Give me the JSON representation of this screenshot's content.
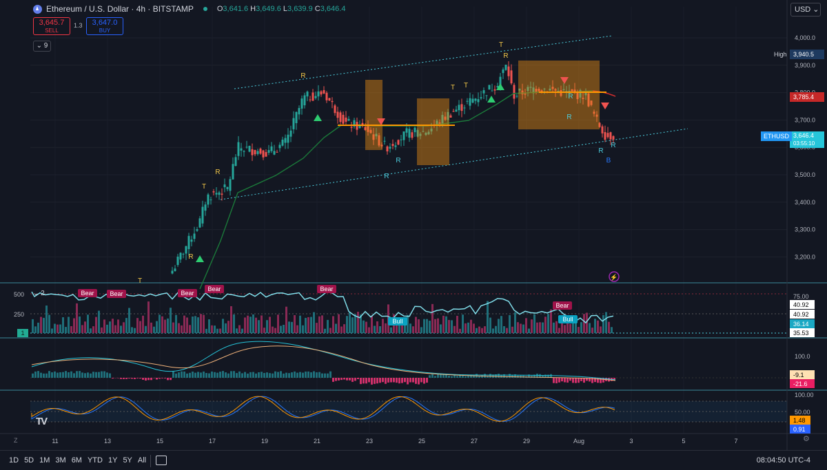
{
  "legend": {
    "symbol": "Ethereum / U.S. Dollar · 4h · BITSTAMP",
    "open_label": "O",
    "open": "3,641.6",
    "high_label": "H",
    "high": "3,649.6",
    "low_label": "L",
    "low": "3,639.9",
    "close_label": "C",
    "close": "3,646.4"
  },
  "trade": {
    "sell_price": "3,645.7",
    "sell_label": "SELL",
    "spread": "1.3",
    "buy_price": "3,647.0",
    "buy_label": "BUY"
  },
  "indicator_count": "9",
  "currency": "USD",
  "price_axis": {
    "ticks": [
      "4,000.0",
      "3,900.0",
      "3,800.0",
      "3,700.0",
      "3,600.0",
      "3,500.0",
      "3,400.0",
      "3,300.0",
      "3,200.0"
    ],
    "high_label": "High",
    "high_value": "3,940.5",
    "red_value": "3,785.4",
    "symbol_tag": "ETHUSD",
    "last_value": "3,646.4",
    "countdown": "03:55:10"
  },
  "pane2": {
    "ticks": [
      "500",
      "250"
    ],
    "collapse_num": "2",
    "right_labels": [
      "75.00",
      "40.92",
      "40.92",
      "36.14",
      "35.53"
    ],
    "tags": [
      "Bear",
      "Bear",
      "Bear",
      "Bear",
      "Bear",
      "Bull",
      "Bear",
      "Bull"
    ],
    "pane_index": "1"
  },
  "pane3": {
    "tick": "100.0",
    "labels": [
      "-9.1",
      "-21.6"
    ]
  },
  "pane4": {
    "ticks": [
      "100.00",
      "50.00"
    ],
    "labels": [
      "1.48",
      "0.91"
    ]
  },
  "time_axis": [
    "11",
    "13",
    "15",
    "17",
    "19",
    "21",
    "23",
    "25",
    "27",
    "29",
    "Aug",
    "3",
    "5",
    "7"
  ],
  "bottom": {
    "ranges": [
      "1D",
      "5D",
      "1M",
      "3M",
      "6M",
      "YTD",
      "1Y",
      "5Y",
      "All"
    ],
    "clock": "08:04:50 UTC-4"
  },
  "chart_data": {
    "type": "candlestick",
    "ylim": [
      3150,
      4050
    ],
    "colors": {
      "up": "#26a69a",
      "down": "#ef5350",
      "background": "#131722"
    },
    "markers": [
      "R",
      "T",
      "B"
    ]
  }
}
